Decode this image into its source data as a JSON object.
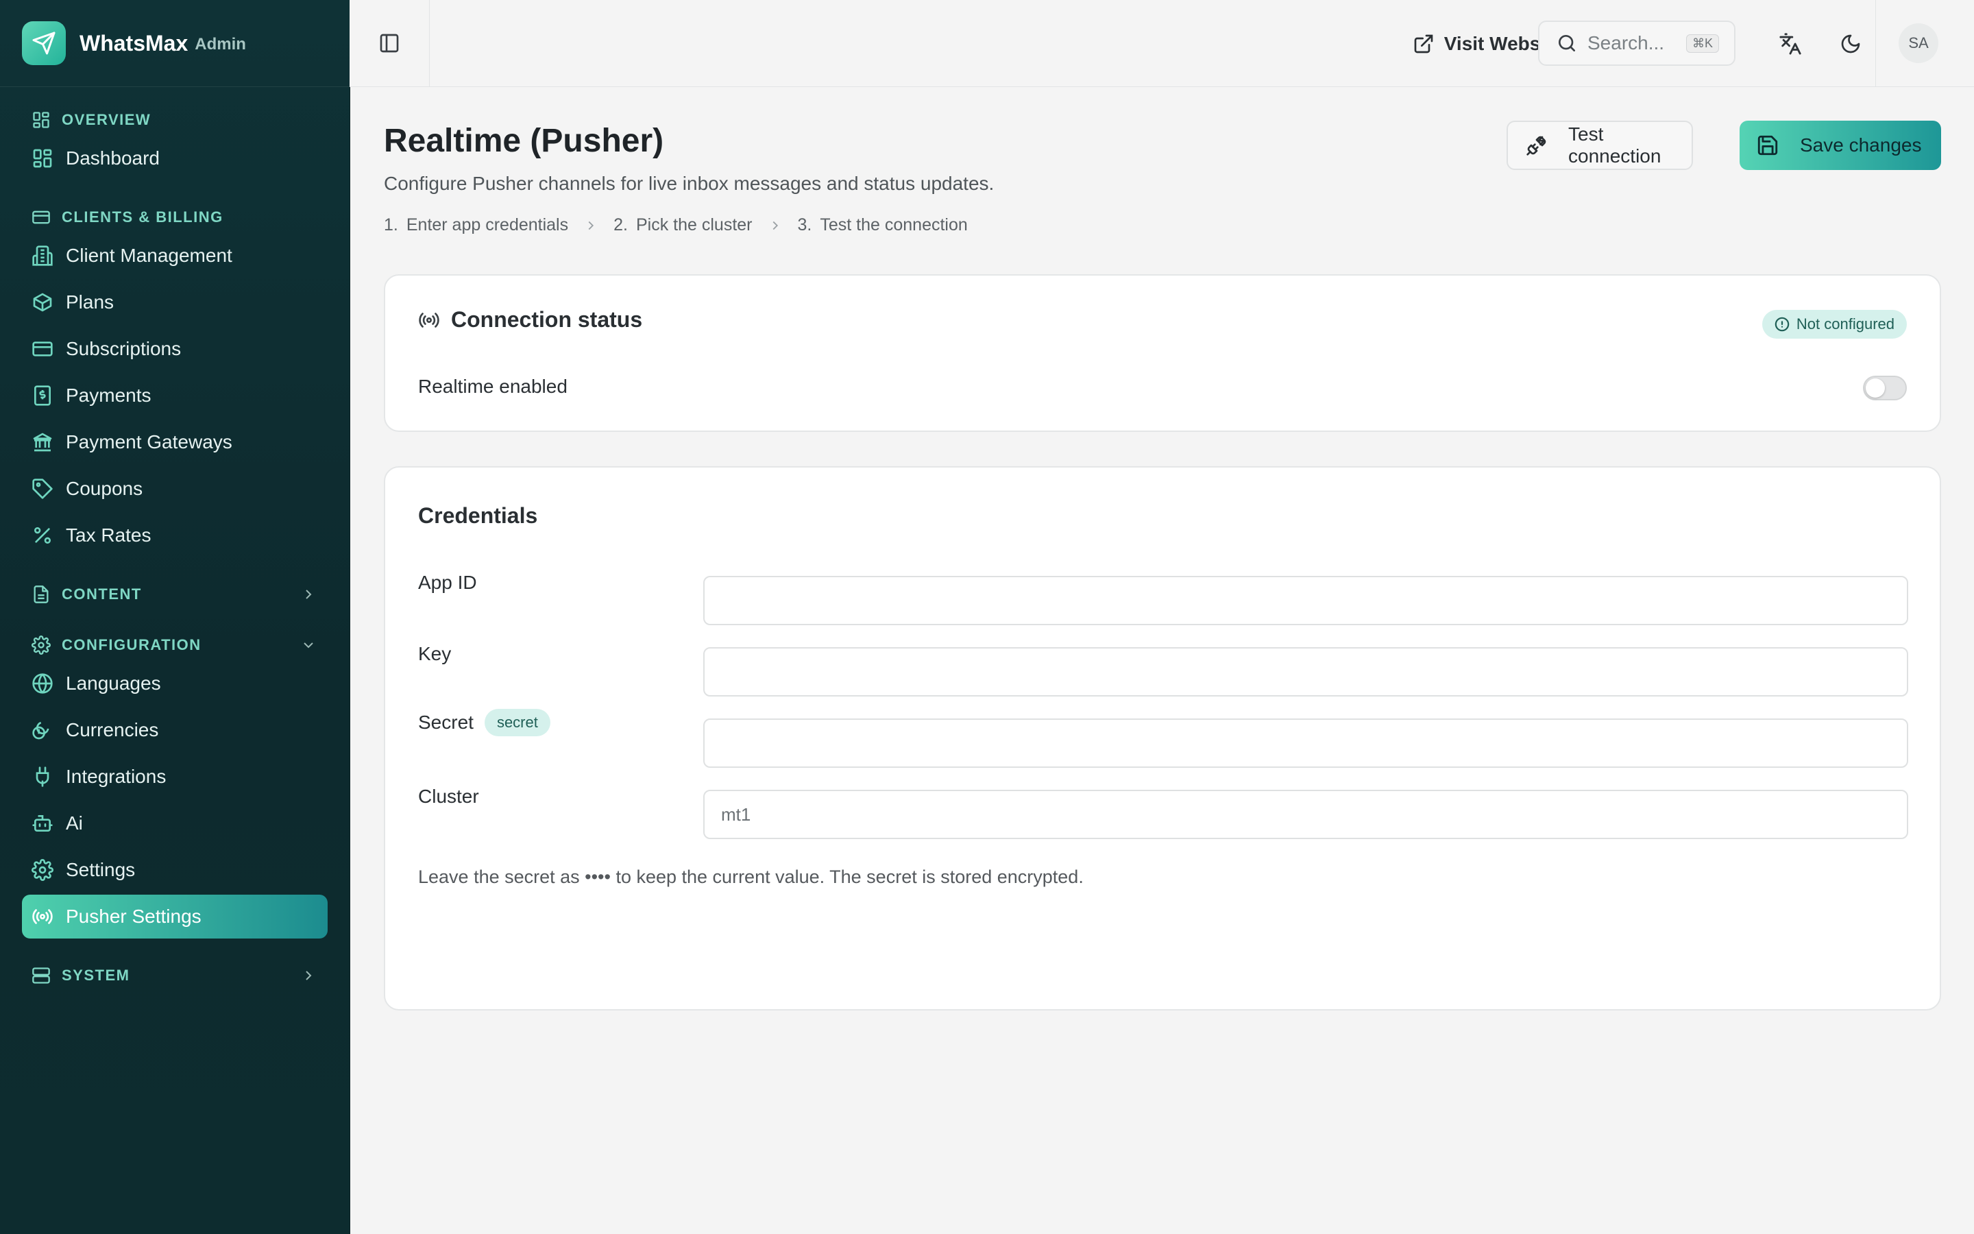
{
  "brand": {
    "name": "WhatsMax",
    "sub": "Admin"
  },
  "sidebar": {
    "sections": [
      {
        "label": "OVERVIEW",
        "items": [
          {
            "label": "Dashboard",
            "icon": "dashboard-icon"
          }
        ]
      },
      {
        "label": "CLIENTS & BILLING",
        "items": [
          {
            "label": "Client Management",
            "icon": "building-icon"
          },
          {
            "label": "Plans",
            "icon": "package-icon"
          },
          {
            "label": "Subscriptions",
            "icon": "credit-card-icon"
          },
          {
            "label": "Payments",
            "icon": "receipt-icon"
          },
          {
            "label": "Payment Gateways",
            "icon": "bank-icon"
          },
          {
            "label": "Coupons",
            "icon": "tag-icon"
          },
          {
            "label": "Tax Rates",
            "icon": "percent-icon"
          }
        ]
      },
      {
        "label": "CONTENT",
        "collapsed": true
      },
      {
        "label": "CONFIGURATION",
        "items": [
          {
            "label": "Languages",
            "icon": "globe-icon"
          },
          {
            "label": "Currencies",
            "icon": "coins-icon"
          },
          {
            "label": "Integrations",
            "icon": "plug-icon"
          },
          {
            "label": "Ai",
            "icon": "bot-icon"
          },
          {
            "label": "Settings",
            "icon": "gear-icon"
          },
          {
            "label": "Pusher Settings",
            "icon": "radio-icon",
            "active": true
          }
        ]
      },
      {
        "label": "SYSTEM",
        "collapsed": true
      }
    ]
  },
  "topbar": {
    "visit_label": "Visit Website",
    "search_placeholder": "Search...",
    "search_shortcut": "⌘K",
    "avatar_initials": "SA"
  },
  "page": {
    "title": "Realtime (Pusher)",
    "subtitle": "Configure Pusher channels for live inbox messages and status updates.",
    "steps": [
      {
        "num": "1.",
        "label": "Enter app credentials"
      },
      {
        "num": "2.",
        "label": "Pick the cluster"
      },
      {
        "num": "3.",
        "label": "Test the connection"
      }
    ],
    "test_label": "Test connection",
    "save_label": "Save changes"
  },
  "status_card": {
    "title": "Connection status",
    "badge": "Not configured",
    "realtime_label": "Realtime enabled",
    "realtime_enabled": false
  },
  "credentials": {
    "title": "Credentials",
    "fields": [
      {
        "label": "App ID",
        "value": ""
      },
      {
        "label": "Key",
        "value": ""
      },
      {
        "label": "Secret",
        "tag": "secret",
        "value": ""
      },
      {
        "label": "Cluster",
        "value": "",
        "placeholder": "mt1"
      }
    ],
    "hint": "Leave the secret as •••• to keep the current value. The secret is stored encrypted."
  },
  "colors": {
    "sidebar_bg": "#0f3236",
    "accent": "#4fd0ad",
    "accent_dark": "#1c8c8f",
    "badge_bg": "#d5f1ec"
  }
}
